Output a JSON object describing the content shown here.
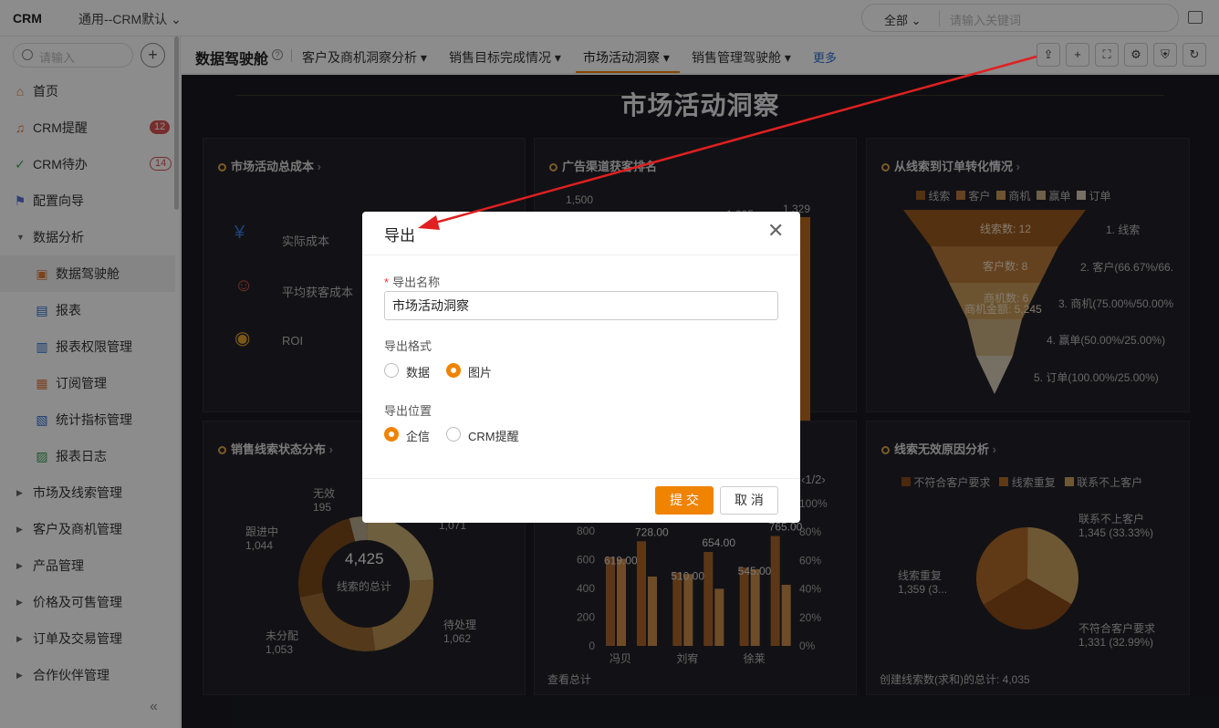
{
  "topbar": {
    "logo": "CRM",
    "app_selector": "通用--CRM默认",
    "search_scope": "全部",
    "search_placeholder": "请输入关键词"
  },
  "sidebar": {
    "search_placeholder": "请输入",
    "items": [
      {
        "label": "首页",
        "icon": "home-icon"
      },
      {
        "label": "CRM提醒",
        "icon": "bell-icon",
        "badge": "12"
      },
      {
        "label": "CRM待办",
        "icon": "check-circle-icon",
        "badge": "14"
      },
      {
        "label": "配置向导",
        "icon": "flag-icon"
      },
      {
        "label": "数据分析",
        "icon": "caret-down-icon"
      },
      {
        "label": "数据驾驶舱",
        "icon": "dashboard-icon"
      },
      {
        "label": "报表",
        "icon": "report-icon"
      },
      {
        "label": "报表权限管理",
        "icon": "report-permission-icon"
      },
      {
        "label": "订阅管理",
        "icon": "subscribe-icon"
      },
      {
        "label": "统计指标管理",
        "icon": "metric-icon"
      },
      {
        "label": "报表日志",
        "icon": "log-icon"
      },
      {
        "label": "市场及线索管理",
        "icon": "caret-right-icon"
      },
      {
        "label": "客户及商机管理",
        "icon": "caret-right-icon"
      },
      {
        "label": "产品管理",
        "icon": "caret-right-icon"
      },
      {
        "label": "价格及可售管理",
        "icon": "caret-right-icon"
      },
      {
        "label": "订单及交易管理",
        "icon": "caret-right-icon"
      },
      {
        "label": "合作伙伴管理",
        "icon": "caret-right-icon"
      }
    ]
  },
  "tabs": {
    "title": "数据驾驶舱",
    "items": [
      "客户及商机洞察分析",
      "销售目标完成情况",
      "市场活动洞察",
      "销售管理驾驶舱"
    ],
    "more": "更多"
  },
  "dashboard": {
    "title": "市场活动洞察",
    "panel1": {
      "title": "市场活动总成本",
      "rows": [
        "实际成本",
        "平均获客成本",
        "ROI"
      ]
    },
    "panel2": {
      "title": "广告渠道获客排名",
      "axis_top": "1,500",
      "labels": [
        "1,295",
        "1,329"
      ]
    },
    "panel3": {
      "title": "从线索到订单转化情况",
      "legend": [
        "线索",
        "客户",
        "商机",
        "赢单",
        "订单"
      ],
      "inner": [
        "线索数: 12",
        "客户数: 8",
        "商机数: 6",
        "商机金额: 5,245"
      ],
      "side": [
        "1. 线索",
        "2. 客户(66.67%/66.",
        "3. 商机(75.00%/50.00%",
        "4. 赢单(50.00%/25.00%)",
        "5. 订单(100.00%/25.00%)"
      ]
    },
    "panel4": {
      "title": "销售线索状态分布",
      "total": "4,425",
      "total_label": "线索的总计",
      "labels": [
        {
          "name": "无效",
          "value": "195"
        },
        {
          "name": "跟进中",
          "value": "1,044"
        },
        {
          "name": "未分配",
          "value": "1,053"
        },
        {
          "name": "待处理",
          "value": "1,062"
        },
        {
          "value": "1,071"
        }
      ]
    },
    "panel5": {
      "page": "1/2",
      "y_left": [
        "800",
        "600",
        "400",
        "200",
        "0"
      ],
      "y_right": [
        "100%",
        "80%",
        "60%",
        "40%",
        "20%",
        "0%"
      ],
      "bar_labels": [
        "619.00",
        "728.00",
        "510.00",
        "654.00",
        "545.00",
        "765.00"
      ],
      "x": [
        "冯贝",
        "刘宥",
        "徐莱"
      ],
      "footer": "查看总计"
    },
    "panel6": {
      "title": "线索无效原因分析",
      "legend": [
        "不符合客户要求",
        "线索重复",
        "联系不上客户"
      ],
      "labels": [
        {
          "name": "联系不上客户",
          "value": "1,345 (33.33%)"
        },
        {
          "name": "线索重复",
          "value": "1,359 (3..."
        },
        {
          "name": "不符合客户要求",
          "value": "1,331 (32.99%)"
        }
      ],
      "footer": "创建线索数(求和)的总计: 4,035"
    }
  },
  "chart_data": [
    {
      "type": "pie",
      "title": "销售线索状态分布",
      "categories": [
        "无效",
        "跟进中",
        "未分配",
        "待处理",
        ""
      ],
      "values": [
        195,
        1044,
        1053,
        1062,
        1071
      ]
    },
    {
      "type": "pie",
      "title": "线索无效原因分析",
      "categories": [
        "不符合客户要求",
        "线索重复",
        "联系不上客户"
      ],
      "values": [
        1331,
        1359,
        1345
      ]
    },
    {
      "type": "bar",
      "categories": [
        "冯贝",
        "刘宥",
        "徐莱"
      ],
      "series": [
        {
          "values": [
            619,
            510,
            545
          ]
        },
        {
          "values": [
            728,
            654,
            765
          ]
        }
      ],
      "ylim": [
        0,
        800
      ]
    }
  ],
  "modal": {
    "title": "导出",
    "name_label": "导出名称",
    "name_value": "市场活动洞察",
    "format_label": "导出格式",
    "format_options": [
      "数据",
      "图片"
    ],
    "location_label": "导出位置",
    "location_options": [
      "企信",
      "CRM提醒"
    ],
    "submit": "提 交",
    "cancel": "取 消"
  },
  "colors": {
    "accent": "#f08300",
    "dashboard_bg": "#1a1b22"
  }
}
